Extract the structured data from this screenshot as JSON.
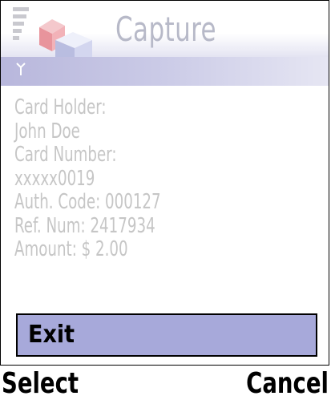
{
  "title_bar": {
    "app_title": "Capture",
    "app_icon": "cubes-icon",
    "signal_icon": "signal-strength-icon"
  },
  "indicator": {
    "antenna_icon": "antenna-icon"
  },
  "transaction": {
    "lines": [
      "Card Holder:",
      "John Doe",
      "Card Number:",
      "xxxxx0019",
      "Auth. Code: 000127",
      "Ref. Num: 2417934",
      "Amount: $ 2.00"
    ]
  },
  "options_menu": {
    "items": [
      "Exit"
    ],
    "selected_index": 0
  },
  "softkeys": {
    "left": "Select",
    "right": "Cancel"
  },
  "colors": {
    "title_text": "#b7b9c8",
    "body_text": "#c6c6c6",
    "highlight": "#a7a9da",
    "indicator_strip": "#c5c5e4"
  }
}
